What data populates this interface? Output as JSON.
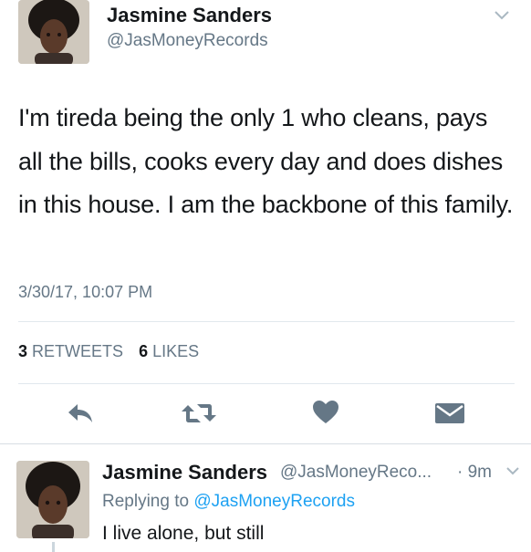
{
  "tweet": {
    "author_name": "Jasmine Sanders",
    "author_handle": "@JasMoneyRecords",
    "text": "I'm tireda being the only 1 who cleans, pays all the bills, cooks every day and does dishes in this house. I am the backbone of this family.",
    "timestamp": "3/30/17, 10:07 PM",
    "retweet_count": "3",
    "retweet_label": "RETWEETS",
    "like_count": "6",
    "like_label": "LIKES"
  },
  "reply": {
    "author_name": "Jasmine Sanders",
    "author_handle": "@JasMoneyReco...",
    "time_ago": "· 9m",
    "replying_prefix": "Replying to",
    "replying_to": "@JasMoneyRecords",
    "text": "I live alone, but still"
  },
  "icons": {
    "reply": "reply-arrow-icon",
    "retweet": "retweet-icon",
    "like": "heart-icon",
    "message": "envelope-icon",
    "menu": "chevron-down-icon"
  },
  "colors": {
    "text": "#14171a",
    "secondary": "#657786",
    "link": "#1da1f2",
    "icon": "#657786",
    "divider": "#e1e8ed"
  }
}
